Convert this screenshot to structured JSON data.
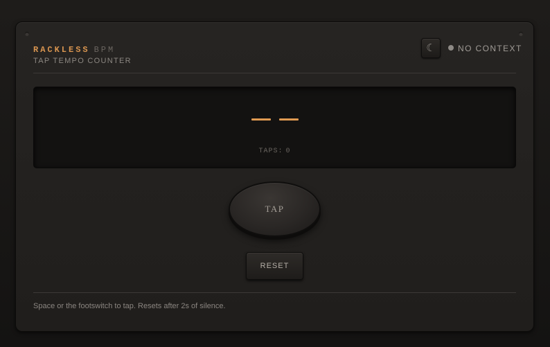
{
  "header": {
    "brand_name": "RACKLESS",
    "brand_suffix": "BPM",
    "subtitle": "TAP TEMPO COUNTER",
    "theme_toggle_icon": "moon-icon",
    "theme_toggle_glyph": "☾",
    "status_text": "NO CONTEXT",
    "status_color": "#8e8a86"
  },
  "display": {
    "bpm_value": "--",
    "taps_label": "TAPS:",
    "taps_count": "0",
    "accent_color": "#e09a52"
  },
  "controls": {
    "tap_label": "TAP",
    "reset_label": "RESET"
  },
  "footer": {
    "hint": "Space or the footswitch to tap. Resets after 2s of silence."
  }
}
